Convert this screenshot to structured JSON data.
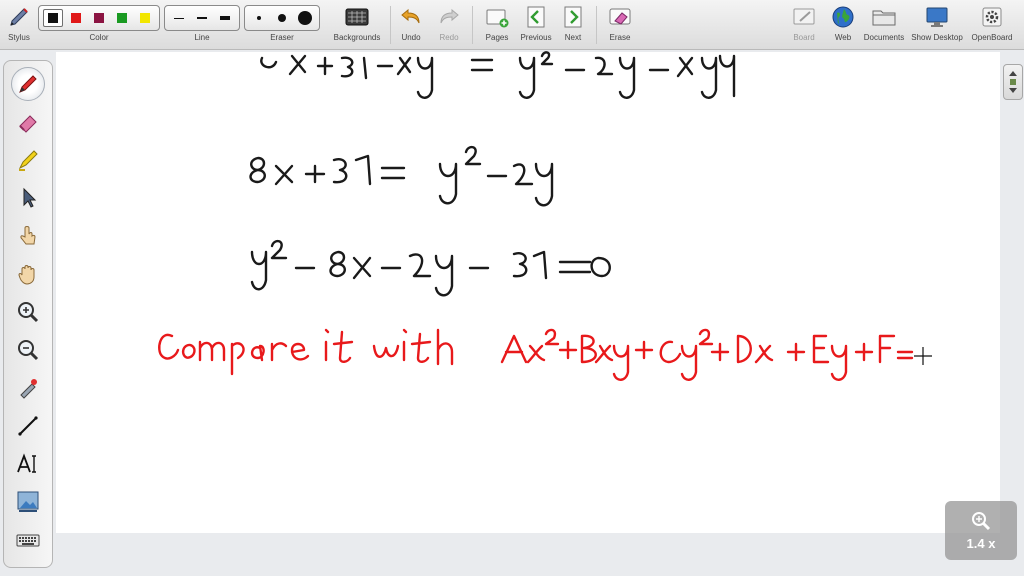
{
  "toolbar": {
    "stylus": "Stylus",
    "color": "Color",
    "line": "Line",
    "eraser": "Eraser",
    "backgrounds": "Backgrounds",
    "undo": "Undo",
    "redo": "Redo",
    "pages": "Pages",
    "previous": "Previous",
    "next": "Next",
    "erase": "Erase",
    "board": "Board",
    "web": "Web",
    "documents": "Documents",
    "show_desktop": "Show Desktop",
    "openboard": "OpenBoard"
  },
  "palette_colors": [
    "#111111",
    "#e01818",
    "#8b1442",
    "#1a9a22",
    "#f2e600"
  ],
  "left_tools": [
    "pen-icon",
    "eraser-icon",
    "highlighter-icon",
    "pointer-icon",
    "hand-pointer-icon",
    "hand-pan-icon",
    "zoom-in-icon",
    "zoom-out-icon",
    "laser-pointer-icon",
    "line-icon",
    "text-icon",
    "capture-icon",
    "keyboard-icon"
  ],
  "zoom": {
    "level": "1.4 x"
  },
  "ink_colors": {
    "black": "#1a1a1a",
    "red": "#e8191b"
  }
}
